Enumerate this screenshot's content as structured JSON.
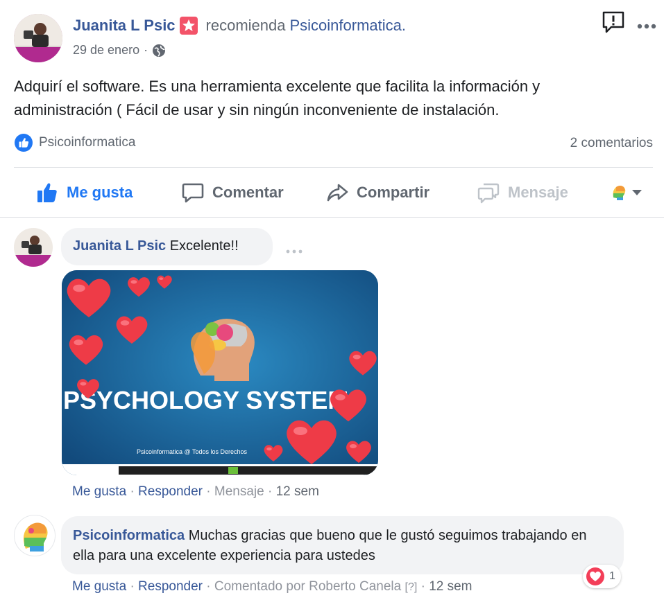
{
  "post": {
    "author": "Juanita L Psic",
    "verb": "recomienda",
    "page": "Psicoinformatica.",
    "date": "29 de enero",
    "dot": "·",
    "body": "Adquirí el software. Es una herramienta excelente que facilita la información y administración ( Fácil de usar y sin ningún inconveniente de instalación.",
    "liked_by": "Psicoinformatica",
    "comment_count": "2 comentarios"
  },
  "actions": {
    "like": "Me gusta",
    "comment": "Comentar",
    "share": "Compartir",
    "message": "Mensaje"
  },
  "comments": [
    {
      "author": "Juanita L Psic",
      "text": "Excelente!!",
      "image_text": "PSYCHOLOGY SYSTEM",
      "image_footer": "Psicoinformatica @ Todos los Derechos",
      "like": "Me gusta",
      "reply": "Responder",
      "message": "Mensaje",
      "time": "12 sem"
    },
    {
      "author": "Psicoinformatica",
      "text": "Muchas gracias que bueno que le gustó seguimos trabajando en ella para una excelente experiencia para ustedes",
      "like": "Me gusta",
      "reply": "Responder",
      "commented_by": "Comentado por Roberto Canela",
      "help": "[?]",
      "time": "12 sem",
      "reaction_count": "1"
    }
  ],
  "colors": {
    "link": "#385898",
    "like_blue": "#2078f4",
    "muted": "#90949c",
    "bubble": "#f2f3f5",
    "recommend_badge": "#f35369"
  }
}
